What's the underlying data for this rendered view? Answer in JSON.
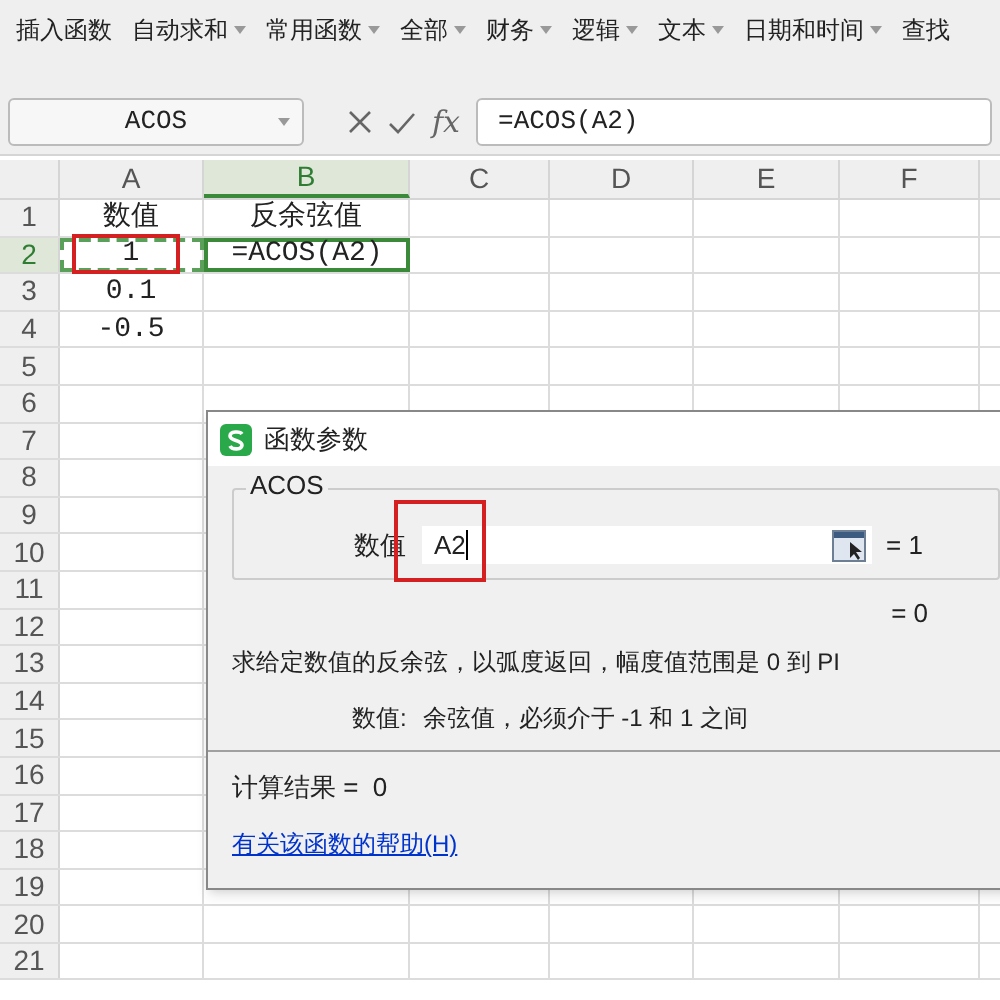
{
  "ribbon": {
    "items": [
      {
        "label": "插入函数",
        "dropdown": false
      },
      {
        "label": "自动求和",
        "dropdown": true
      },
      {
        "label": "常用函数",
        "dropdown": true
      },
      {
        "label": "全部",
        "dropdown": true
      },
      {
        "label": "财务",
        "dropdown": true
      },
      {
        "label": "逻辑",
        "dropdown": true
      },
      {
        "label": "文本",
        "dropdown": true
      },
      {
        "label": "日期和时间",
        "dropdown": true
      },
      {
        "label": "查找",
        "dropdown": false
      }
    ]
  },
  "formula_bar": {
    "name_box": "ACOS",
    "fx_label": "fx",
    "formula": "=ACOS(A2)"
  },
  "sheet": {
    "columns": [
      {
        "label": "A",
        "selected": false
      },
      {
        "label": "B",
        "selected": true
      },
      {
        "label": "C",
        "selected": false
      },
      {
        "label": "D",
        "selected": false
      },
      {
        "label": "E",
        "selected": false
      },
      {
        "label": "F",
        "selected": false
      }
    ],
    "rows": [
      {
        "label": "1",
        "selected": false,
        "cells": [
          {
            "text": "数值",
            "selected": false,
            "marquee": false
          },
          {
            "text": "反余弦值",
            "selected": false,
            "marquee": false
          }
        ]
      },
      {
        "label": "2",
        "selected": true,
        "cells": [
          {
            "text": "1",
            "selected": false,
            "marquee": true
          },
          {
            "text": "=ACOS(A2)",
            "selected": true,
            "marquee": false
          }
        ]
      },
      {
        "label": "3",
        "selected": false,
        "cells": [
          {
            "text": "0.1",
            "selected": false,
            "marquee": false
          }
        ]
      },
      {
        "label": "4",
        "selected": false,
        "cells": [
          {
            "text": "-0.5",
            "selected": false,
            "marquee": false
          }
        ]
      },
      {
        "label": "5",
        "selected": false,
        "cells": []
      },
      {
        "label": "6",
        "selected": false,
        "cells": []
      },
      {
        "label": "7",
        "selected": false,
        "cells": []
      },
      {
        "label": "8",
        "selected": false,
        "cells": []
      },
      {
        "label": "9",
        "selected": false,
        "cells": []
      },
      {
        "label": "10",
        "selected": false,
        "cells": []
      },
      {
        "label": "11",
        "selected": false,
        "cells": []
      },
      {
        "label": "12",
        "selected": false,
        "cells": []
      },
      {
        "label": "13",
        "selected": false,
        "cells": []
      },
      {
        "label": "14",
        "selected": false,
        "cells": []
      },
      {
        "label": "15",
        "selected": false,
        "cells": []
      },
      {
        "label": "16",
        "selected": false,
        "cells": []
      },
      {
        "label": "17",
        "selected": false,
        "cells": []
      },
      {
        "label": "18",
        "selected": false,
        "cells": []
      },
      {
        "label": "19",
        "selected": false,
        "cells": []
      },
      {
        "label": "20",
        "selected": false,
        "cells": []
      },
      {
        "label": "21",
        "selected": false,
        "cells": []
      }
    ]
  },
  "dialog": {
    "title": "函数参数",
    "group": "ACOS",
    "argument": {
      "label": "数值",
      "value": "A2",
      "result": "= 1"
    },
    "formula_result": "= 0",
    "description": "求给定数值的反余弦，以弧度返回，幅度值范围是 0 到 PI",
    "argument_help": {
      "label": "数值:",
      "text": "余弦值，必须介于 -1 和 1 之间"
    },
    "calc_result": "计算结果 =  0",
    "help_link": "有关该函数的帮助(H)"
  }
}
